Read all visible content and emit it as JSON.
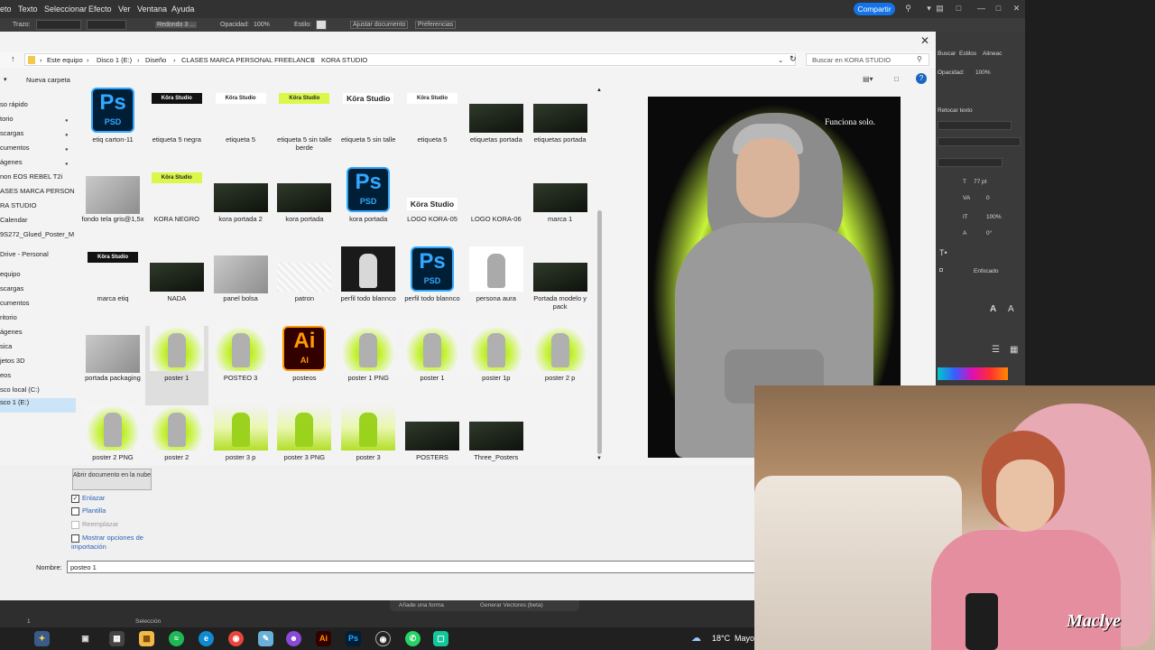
{
  "menubar": {
    "items": [
      "eto",
      "Texto",
      "Seleccionar",
      "Efecto",
      "Ver",
      "Ventana",
      "Ayuda"
    ],
    "share_label": "Compartir"
  },
  "controlbar": {
    "items": [
      "Trazo:",
      "Redondo 3 ...",
      "Opacidad:",
      "100%",
      "Estilo:",
      "Ajustar documento",
      "Preferencias"
    ]
  },
  "dialog": {
    "breadcrumbs": [
      "Este equipo",
      "Disco 1 (E:)",
      "Diseño",
      "CLASES MARCA PERSONAL FREELANCE",
      "KORA STUDIO"
    ],
    "search_placeholder": "Buscar en KORA STUDIO",
    "new_folder_label": "Nueva carpeta",
    "nav_items": [
      "so rápido",
      "torio",
      "scargas",
      "cumentos",
      "ágenes",
      "non EOS REBEL T2i",
      "ASES MARCA PERSON",
      "RA STUDIO",
      "Calendar",
      "9S272_Glued_Poster_M",
      "Drive - Personal",
      "equipo",
      "scargas",
      "cumentos",
      "ritorio",
      "ágenes",
      "sica",
      "jetos 3D",
      "eos",
      "sco local (C:)",
      "sco 1 (E:)"
    ],
    "files": [
      {
        "name": "etiq carton-11",
        "kind": "ps"
      },
      {
        "name": "etiqueta 5 negra",
        "kind": "black",
        "text": "Köra Studio"
      },
      {
        "name": "etiqueta 5",
        "kind": "white",
        "text": "Köra Studio"
      },
      {
        "name": "etiqueta 5 sin talle berde",
        "kind": "lime",
        "text": "Köra Studio"
      },
      {
        "name": "etiqueta 5 sin talle",
        "kind": "whitebig",
        "text": "Köra Studio"
      },
      {
        "name": "etiqueta 5",
        "kind": "white",
        "text": "Köra Studio"
      },
      {
        "name": "etiquetas portada",
        "kind": "dark"
      },
      {
        "name": "etiquetas portada",
        "kind": "dark"
      },
      {
        "name": "fondo tela gris@1,5x",
        "kind": "gray"
      },
      {
        "name": "KORA NEGRO",
        "kind": "lime",
        "text": "Köra Studio"
      },
      {
        "name": "kora portada 2",
        "kind": "dark"
      },
      {
        "name": "kora portada",
        "kind": "dark"
      },
      {
        "name": "kora portada",
        "kind": "ps"
      },
      {
        "name": "LOGO KORA-05",
        "kind": "logo",
        "text": "Köra Studio"
      },
      {
        "name": "LOGO KORA-06",
        "kind": "empty"
      },
      {
        "name": "marca 1",
        "kind": "dark"
      },
      {
        "name": "marca etiq",
        "kind": "black",
        "text": "Köra Studio"
      },
      {
        "name": "NADA",
        "kind": "dark"
      },
      {
        "name": "panel bolsa",
        "kind": "gray"
      },
      {
        "name": "patron",
        "kind": "pattern"
      },
      {
        "name": "perfil todo blannco",
        "kind": "figdark"
      },
      {
        "name": "perfil todo blannco",
        "kind": "ps"
      },
      {
        "name": "persona aura",
        "kind": "figwhite"
      },
      {
        "name": "Portada modelo y pack",
        "kind": "dark"
      },
      {
        "name": "portada packaging",
        "kind": "gray"
      },
      {
        "name": "poster 1",
        "kind": "limefig",
        "selected": true
      },
      {
        "name": "POSTEO 3",
        "kind": "limefig"
      },
      {
        "name": "posteos",
        "kind": "ai"
      },
      {
        "name": "poster 1 PNG",
        "kind": "limefig"
      },
      {
        "name": "poster 1",
        "kind": "limefig"
      },
      {
        "name": "poster 1p",
        "kind": "limefig"
      },
      {
        "name": "poster 2 p",
        "kind": "limefig"
      },
      {
        "name": "poster 2 PNG",
        "kind": "limefig"
      },
      {
        "name": "poster 2",
        "kind": "limefig"
      },
      {
        "name": "poster 3 p",
        "kind": "poster"
      },
      {
        "name": "poster 3 PNG",
        "kind": "poster"
      },
      {
        "name": "poster 3",
        "kind": "poster"
      },
      {
        "name": "POSTERS",
        "kind": "dark"
      },
      {
        "name": "Three_Posters",
        "kind": "dark"
      }
    ],
    "icon_labels": {
      "ps_big": "Ps",
      "ps_small": "PSD",
      "ai_big": "Ai",
      "ai_small": "AI"
    },
    "preview_tagline": "Funciona solo.",
    "cloud_button": "Abrir documento en la nube",
    "checkbox_enlazar": "Enlazar",
    "checkbox_plantilla": "Plantilla",
    "checkbox_reemplazar": "Reemplazar",
    "checkbox_opciones": "Mostrar opciones de importación",
    "name_label": "Nombre:",
    "name_value": "posteo 1"
  },
  "rpanel": {
    "tab_items": [
      "Buscar",
      "Estilos",
      "Alineac"
    ],
    "opacity_label": "Opacidad:",
    "opacity_value": "100%",
    "retouch_label": "Retocar texto",
    "font_size": "77 pt",
    "tracking": "0",
    "scale": "100%",
    "rotation": "0°",
    "aa_label": "Enfocado"
  },
  "aistatus": {
    "ctx_items": [
      "Añade una forma",
      "Generar Vectores (beta)"
    ],
    "zoom": "1",
    "selection_label": "Selección"
  },
  "taskbar": {
    "weather": "18°C",
    "weather_text": "Mayo"
  },
  "webcam": {
    "brand": "Maclye"
  }
}
